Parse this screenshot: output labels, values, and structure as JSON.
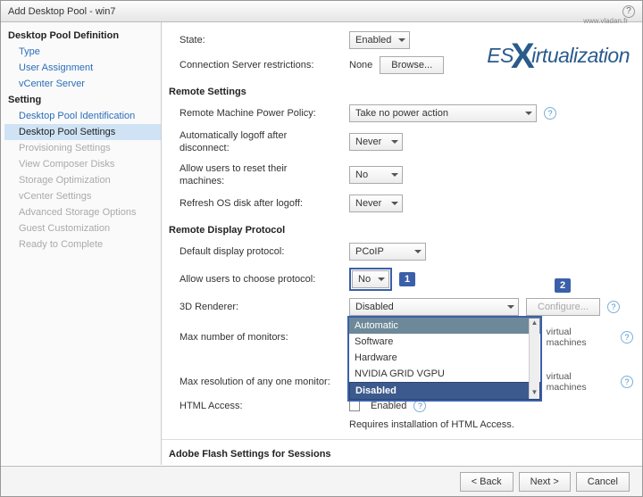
{
  "window": {
    "title": "Add Desktop Pool - win7"
  },
  "sidebar": {
    "group1": {
      "title": "Desktop Pool Definition",
      "items": [
        "Type",
        "User Assignment",
        "vCenter Server"
      ]
    },
    "group2": {
      "title": "Setting",
      "items": [
        "Desktop Pool Identification",
        "Desktop Pool Settings",
        "Provisioning Settings",
        "View Composer Disks",
        "Storage Optimization",
        "vCenter Settings",
        "Advanced Storage Options",
        "Guest Customization",
        "Ready to Complete"
      ]
    }
  },
  "main": {
    "state": {
      "label": "State:",
      "value": "Enabled"
    },
    "conn": {
      "label": "Connection Server restrictions:",
      "value": "None",
      "browse": "Browse..."
    },
    "section_remote_settings": "Remote Settings",
    "power": {
      "label": "Remote Machine Power Policy:",
      "value": "Take no power action"
    },
    "logoff": {
      "label": "Automatically logoff after disconnect:",
      "value": "Never"
    },
    "reset": {
      "label": "Allow users to reset their machines:",
      "value": "No"
    },
    "refresh": {
      "label": "Refresh OS disk after logoff:",
      "value": "Never"
    },
    "section_remote_display": "Remote Display Protocol",
    "proto": {
      "label": "Default display protocol:",
      "value": "PCoIP"
    },
    "choose": {
      "label": "Allow users to choose protocol:",
      "value": "No"
    },
    "renderer": {
      "label": "3D Renderer:",
      "value": "Disabled",
      "configure": "Configure...",
      "options": [
        "Automatic",
        "Software",
        "Hardware",
        "NVIDIA GRID VGPU",
        "Disabled"
      ]
    },
    "monitors": {
      "label": "Max number of monitors:",
      "note": "virtual machines"
    },
    "maxres": {
      "label": "Max resolution of any one monitor:",
      "note": "virtual machines"
    },
    "html": {
      "label": "HTML Access:",
      "checkbox": "Enabled",
      "note": "Requires installation of HTML Access."
    },
    "section_flash": "Adobe Flash Settings for Sessions"
  },
  "annotations": {
    "one": "1",
    "two": "2"
  },
  "logo": {
    "text_es": "ES",
    "text_rest": "irtualization",
    "url": "www.vladan.fr"
  },
  "footer": {
    "back": "< Back",
    "next": "Next >",
    "cancel": "Cancel"
  }
}
